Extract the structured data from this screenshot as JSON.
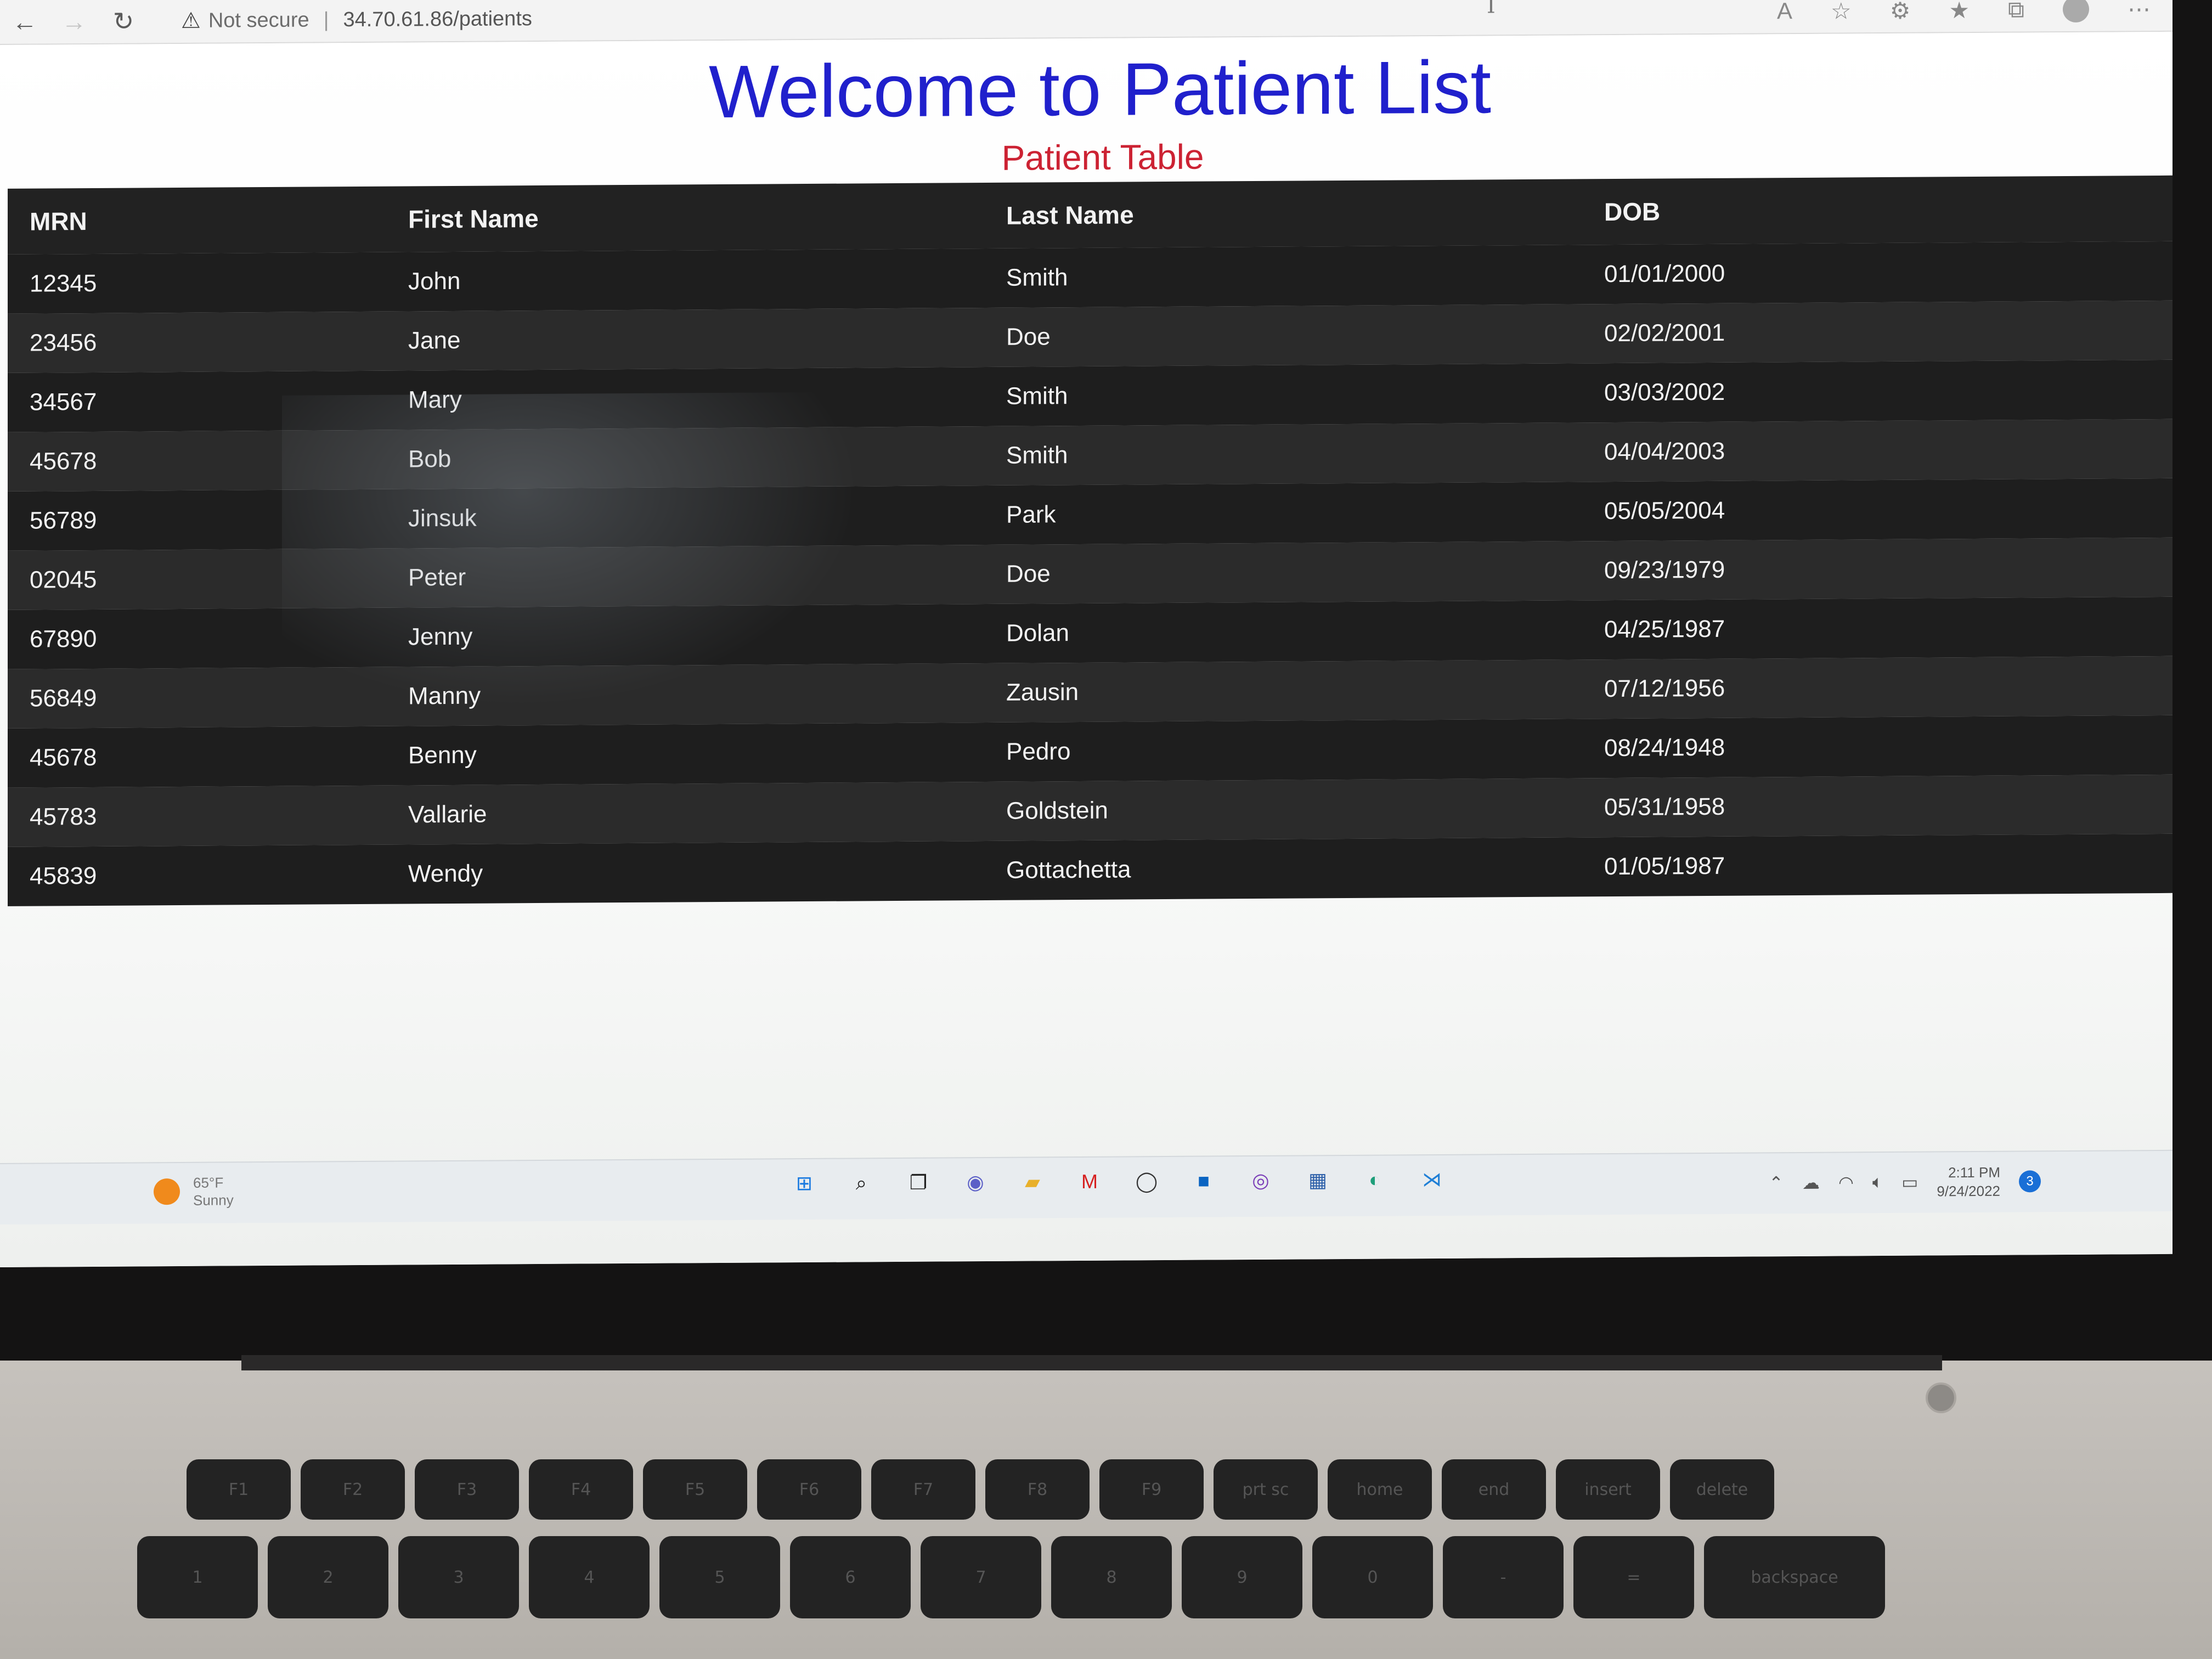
{
  "browser": {
    "back_icon": "←",
    "forward_icon": "→",
    "reload_icon": "↻",
    "security_icon": "⚠",
    "security_label": "Not secure",
    "separator": "|",
    "url": "34.70.61.86/patients"
  },
  "page": {
    "title": "Welcome to Patient List",
    "subtitle": "Patient Table"
  },
  "table": {
    "headers": {
      "mrn": "MRN",
      "first_name": "First Name",
      "last_name": "Last Name",
      "dob": "DOB"
    },
    "rows": [
      {
        "mrn": "12345",
        "first_name": "John",
        "last_name": "Smith",
        "dob": "01/01/2000"
      },
      {
        "mrn": "23456",
        "first_name": "Jane",
        "last_name": "Doe",
        "dob": "02/02/2001"
      },
      {
        "mrn": "34567",
        "first_name": "Mary",
        "last_name": "Smith",
        "dob": "03/03/2002"
      },
      {
        "mrn": "45678",
        "first_name": "Bob",
        "last_name": "Smith",
        "dob": "04/04/2003"
      },
      {
        "mrn": "56789",
        "first_name": "Jinsuk",
        "last_name": "Park",
        "dob": "05/05/2004"
      },
      {
        "mrn": "02045",
        "first_name": "Peter",
        "last_name": "Doe",
        "dob": "09/23/1979"
      },
      {
        "mrn": "67890",
        "first_name": "Jenny",
        "last_name": "Dolan",
        "dob": "04/25/1987"
      },
      {
        "mrn": "56849",
        "first_name": "Manny",
        "last_name": "Zausin",
        "dob": "07/12/1956"
      },
      {
        "mrn": "45678",
        "first_name": "Benny",
        "last_name": "Pedro",
        "dob": "08/24/1948"
      },
      {
        "mrn": "45783",
        "first_name": "Vallarie",
        "last_name": "Goldstein",
        "dob": "05/31/1958"
      },
      {
        "mrn": "45839",
        "first_name": "Wendy",
        "last_name": "Gottachetta",
        "dob": "01/05/1987"
      }
    ]
  },
  "taskbar": {
    "weather_temp": "65°F",
    "weather_cond": "Sunny",
    "time": "2:11 PM",
    "date": "9/24/2022",
    "notifications": "3",
    "apps": [
      "windows-start-icon",
      "search-icon",
      "task-view-icon",
      "chat-icon",
      "file-explorer-icon",
      "mcafee-icon",
      "dell-icon",
      "outlook-icon",
      "github-icon",
      "store-icon",
      "edge-icon",
      "vscode-icon"
    ]
  },
  "keyboard": {
    "function_keys": [
      "F1",
      "F2",
      "F3",
      "F4",
      "F5",
      "F6",
      "F7",
      "F8",
      "F9",
      "prt sc",
      "home",
      "end",
      "insert",
      "delete"
    ],
    "number_keys": [
      "1",
      "2",
      "3",
      "4",
      "5",
      "6",
      "7",
      "8",
      "9",
      "0",
      "-",
      "=",
      "backspace"
    ]
  },
  "colors": {
    "title": "#2020cc",
    "subtitle": "#cc2233",
    "table_bg": "#1e1e1e",
    "table_text": "#f4f4f4"
  }
}
